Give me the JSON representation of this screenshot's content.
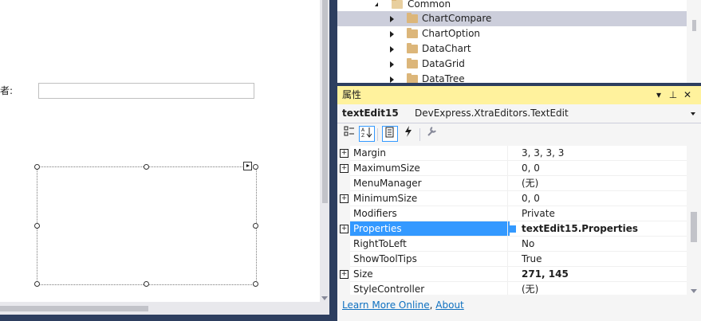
{
  "designer": {
    "field_label": "者:"
  },
  "solution_tree": {
    "items": [
      {
        "label": "Common",
        "expanded": true
      },
      {
        "label": "ChartCompare",
        "selected": true
      },
      {
        "label": "ChartOption"
      },
      {
        "label": "DataChart"
      },
      {
        "label": "DataGrid"
      },
      {
        "label": "DataTree"
      }
    ]
  },
  "properties": {
    "panel_title": "属性",
    "header_icons": [
      "chevron-down-icon",
      "pin-icon",
      "close-icon"
    ],
    "object_name": "textEdit15",
    "object_type": "DevExpress.XtraEditors.TextEdit",
    "toolbar": [
      "categorized-icon",
      "alphabetical-icon",
      "properties-icon",
      "events-icon",
      "property-pages-icon"
    ],
    "rows": [
      {
        "name": "Margin",
        "value": "3, 3, 3, 3",
        "expandable": true
      },
      {
        "name": "MaximumSize",
        "value": "0, 0",
        "expandable": true
      },
      {
        "name": "MenuManager",
        "value": "(无)",
        "expandable": false
      },
      {
        "name": "MinimumSize",
        "value": "0, 0",
        "expandable": true
      },
      {
        "name": "Modifiers",
        "value": "Private",
        "expandable": false
      },
      {
        "name": "Properties",
        "value": "textEdit15.Properties",
        "expandable": true,
        "selected": true,
        "bold": true
      },
      {
        "name": "RightToLeft",
        "value": "No",
        "expandable": false
      },
      {
        "name": "ShowToolTips",
        "value": "True",
        "expandable": false
      },
      {
        "name": "Size",
        "value": "271, 145",
        "expandable": true,
        "bold": true
      },
      {
        "name": "StyleController",
        "value": "(无)",
        "expandable": false
      }
    ],
    "links": {
      "learn_more": "Learn More Online",
      "separator": ",",
      "about": "About"
    }
  },
  "colors": {
    "accent": "#3399ff",
    "panel_header": "#fff29d",
    "frame": "#2d3e5f",
    "selection_tree": "#cccedb",
    "link": "#0e70c0"
  }
}
